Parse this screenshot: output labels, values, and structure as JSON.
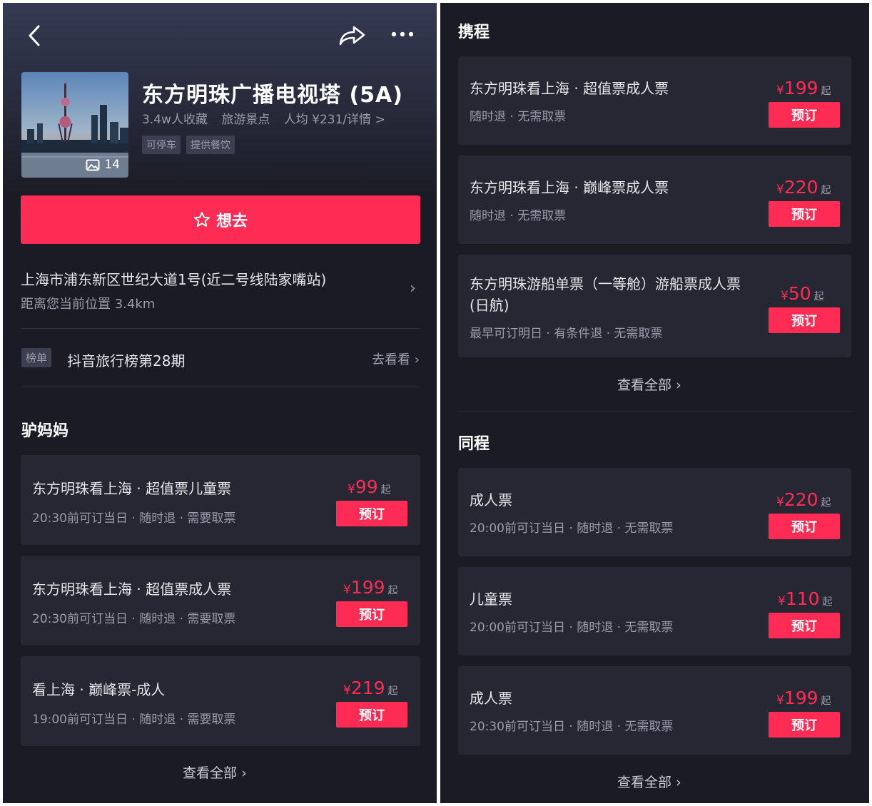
{
  "left": {
    "header": {
      "photo_count": "14"
    },
    "poi": {
      "title": "东方明珠广播电视塔 (5A)",
      "favorites": "3.4w人收藏",
      "category": "旅游景点",
      "avg_price": "人均 ¥231/详情 >",
      "tags": [
        "可停车",
        "提供餐饮"
      ]
    },
    "want_button": "想去",
    "address": {
      "text": "上海市浦东新区世纪大道1号(近二号线陆家嘴站)",
      "distance": "距离您当前位置 3.4km"
    },
    "rank": {
      "badge": "榜单",
      "text": "抖音旅行榜第28期",
      "action": "去看看"
    },
    "section": {
      "title": "驴妈妈",
      "items": [
        {
          "name": "东方明珠看上海 · 超值票儿童票",
          "sub": "20:30前可订当日 · 随时退 · 需要取票",
          "yen": "¥",
          "price": "99",
          "qi": "起",
          "book": "预订"
        },
        {
          "name": "东方明珠看上海 · 超值票成人票",
          "sub": "20:30前可订当日 · 随时退 · 需要取票",
          "yen": "¥",
          "price": "199",
          "qi": "起",
          "book": "预订"
        },
        {
          "name": "看上海 · 巅峰票-成人",
          "sub": "19:00前可订当日 · 随时退 · 需要取票",
          "yen": "¥",
          "price": "219",
          "qi": "起",
          "book": "预订"
        }
      ],
      "see_all": "查看全部"
    }
  },
  "right": {
    "section1": {
      "title": "携程",
      "items": [
        {
          "name": "东方明珠看上海 · 超值票成人票",
          "sub": "随时退 · 无需取票",
          "yen": "¥",
          "price": "199",
          "qi": "起",
          "book": "预订"
        },
        {
          "name": "东方明珠看上海 · 巅峰票成人票",
          "sub": "随时退 · 无需取票",
          "yen": "¥",
          "price": "220",
          "qi": "起",
          "book": "预订"
        },
        {
          "name": "东方明珠游船单票（一等舱）游船票成人票 (日航)",
          "sub": "最早可订明日 · 有条件退 · 无需取票",
          "yen": "¥",
          "price": "50",
          "qi": "起",
          "book": "预订"
        }
      ],
      "see_all": "查看全部"
    },
    "section2": {
      "title": "同程",
      "items": [
        {
          "name": "成人票",
          "sub": "20:00前可订当日 · 随时退 · 无需取票",
          "yen": "¥",
          "price": "220",
          "qi": "起",
          "book": "预订"
        },
        {
          "name": "儿童票",
          "sub": "20:00前可订当日 · 随时退 · 无需取票",
          "yen": "¥",
          "price": "110",
          "qi": "起",
          "book": "预订"
        },
        {
          "name": "成人票",
          "sub": "20:30前可订当日 · 随时退 · 无需取票",
          "yen": "¥",
          "price": "199",
          "qi": "起",
          "book": "预订"
        }
      ],
      "see_all": "查看全部"
    }
  },
  "colors": {
    "accent": "#fe2c55",
    "background": "#1a1b24",
    "card": "#262733",
    "muted_text": "#9a9cab"
  }
}
